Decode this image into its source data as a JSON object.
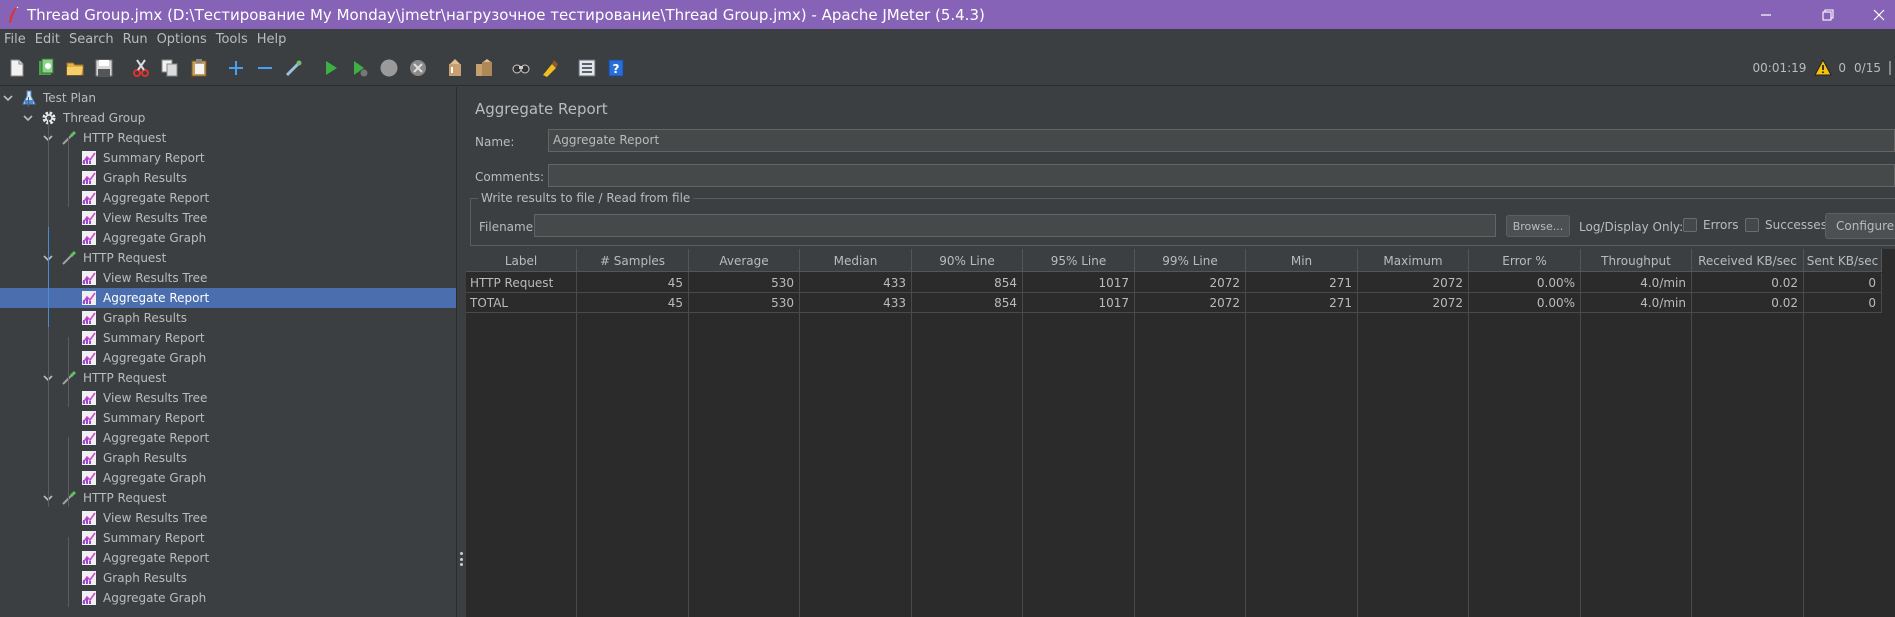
{
  "window": {
    "title": "Thread Group.jmx (D:\\Тестирование My Monday\\jmetr\\нагрузочное тестирование\\Thread Group.jmx) - Apache JMeter (5.4.3)",
    "controls": [
      "minimize-icon",
      "restore-icon",
      "close-icon"
    ]
  },
  "menu": [
    {
      "label": "File"
    },
    {
      "label": "Edit"
    },
    {
      "label": "Search"
    },
    {
      "label": "Run"
    },
    {
      "label": "Options"
    },
    {
      "label": "Tools"
    },
    {
      "label": "Help"
    }
  ],
  "toolbar": {
    "icons": [
      "new-icon",
      "templates-icon",
      "open-icon",
      "save-icon",
      "cut-icon",
      "copy-icon",
      "paste-icon",
      "expand-icon",
      "collapse-icon",
      "toggle-icon",
      "start-icon",
      "start-no-pause-icon",
      "stop-icon",
      "shutdown-icon",
      "clear-icon",
      "clear-all-icon",
      "search-icon",
      "reset-search-icon",
      "function-helper-icon",
      "help-icon"
    ],
    "timer": "00:01:19",
    "warnings": "0",
    "threads": "0/15"
  },
  "tree": {
    "items": [
      {
        "label": "Test Plan",
        "icon": "test-plan-icon",
        "level": 0
      },
      {
        "label": "Thread Group",
        "icon": "thread-group-gear-icon",
        "level": 1
      },
      {
        "label": "HTTP Request",
        "icon": "http-sampler-pipette-icon",
        "level": 2
      },
      {
        "label": "Summary Report",
        "icon": "listener-chart-icon",
        "level": 3
      },
      {
        "label": "Graph Results",
        "icon": "listener-chart-icon",
        "level": 3
      },
      {
        "label": "Aggregate Report",
        "icon": "listener-chart-icon",
        "level": 3
      },
      {
        "label": "View Results Tree",
        "icon": "listener-chart-icon",
        "level": 3
      },
      {
        "label": "Aggregate Graph",
        "icon": "listener-chart-icon",
        "level": 3
      },
      {
        "label": "HTTP Request",
        "icon": "http-sampler-pipette-icon",
        "level": 2
      },
      {
        "label": "View Results Tree",
        "icon": "listener-chart-icon",
        "level": 3
      },
      {
        "label": "Aggregate Report",
        "icon": "listener-chart-icon",
        "level": 3,
        "selected": true
      },
      {
        "label": "Graph Results",
        "icon": "listener-chart-icon",
        "level": 3
      },
      {
        "label": "Summary Report",
        "icon": "listener-chart-icon",
        "level": 3
      },
      {
        "label": "Aggregate Graph",
        "icon": "listener-chart-icon",
        "level": 3
      },
      {
        "label": "HTTP Request",
        "icon": "http-sampler-pipette-icon",
        "level": 2
      },
      {
        "label": "View Results Tree",
        "icon": "listener-chart-icon",
        "level": 3
      },
      {
        "label": "Summary Report",
        "icon": "listener-chart-icon",
        "level": 3
      },
      {
        "label": "Aggregate Report",
        "icon": "listener-chart-icon",
        "level": 3
      },
      {
        "label": "Graph Results",
        "icon": "listener-chart-icon",
        "level": 3
      },
      {
        "label": "Aggregate Graph",
        "icon": "listener-chart-icon",
        "level": 3
      },
      {
        "label": "HTTP Request",
        "icon": "http-sampler-pipette-icon",
        "level": 2
      },
      {
        "label": "View Results Tree",
        "icon": "listener-chart-icon",
        "level": 3
      },
      {
        "label": "Summary Report",
        "icon": "listener-chart-icon",
        "level": 3
      },
      {
        "label": "Aggregate Report",
        "icon": "listener-chart-icon",
        "level": 3
      },
      {
        "label": "Graph Results",
        "icon": "listener-chart-icon",
        "level": 3
      },
      {
        "label": "Aggregate Graph",
        "icon": "listener-chart-icon",
        "level": 3
      }
    ]
  },
  "panel": {
    "title": "Aggregate Report",
    "name_label": "Name:",
    "name_value": "Aggregate Report",
    "comments_label": "Comments:",
    "comments_value": "",
    "file_group_label": "Write results to file / Read from file",
    "filename_label": "Filename",
    "filename_value": "",
    "browse_label": "Browse...",
    "log_display_label": "Log/Display Only:",
    "errors_label": "Errors",
    "successes_label": "Successes",
    "configure_label": "Configure"
  },
  "table": {
    "columns": [
      "Label",
      "# Samples",
      "Average",
      "Median",
      "90% Line",
      "95% Line",
      "99% Line",
      "Min",
      "Maximum",
      "Error %",
      "Throughput",
      "Received KB/sec",
      "Sent KB/sec"
    ],
    "rows": [
      [
        "HTTP Request",
        "45",
        "530",
        "433",
        "854",
        "1017",
        "2072",
        "271",
        "2072",
        "0.00%",
        "4.0/min",
        "0.02",
        "0"
      ],
      [
        "TOTAL",
        "45",
        "530",
        "433",
        "854",
        "1017",
        "2072",
        "271",
        "2072",
        "0.00%",
        "4.0/min",
        "0.02",
        "0"
      ]
    ]
  },
  "colors": {
    "titlebar": "#8663b6",
    "background": "#3c3f41",
    "selection": "#4b6eaf",
    "table_background": "#2b2b2b"
  }
}
